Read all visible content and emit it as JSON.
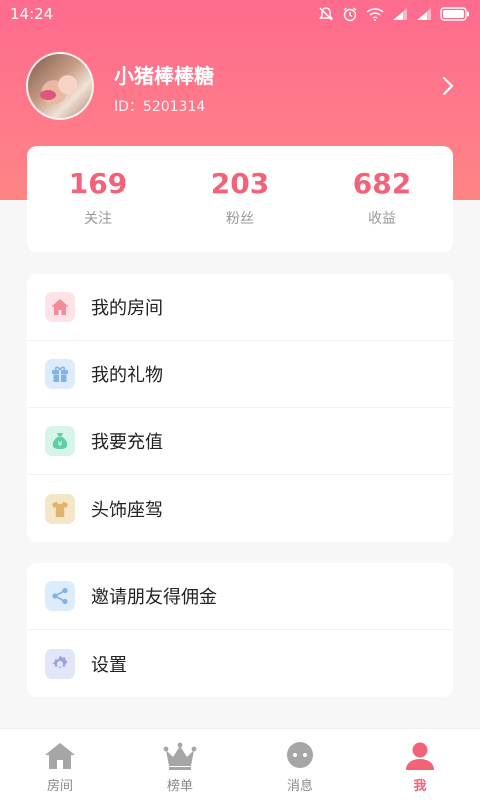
{
  "status_bar": {
    "time": "14:24"
  },
  "profile": {
    "nickname": "小猪棒棒糖",
    "id_text": "ID：5201314"
  },
  "stats": [
    {
      "value": "169",
      "label": "关注"
    },
    {
      "value": "203",
      "label": "粉丝"
    },
    {
      "value": "682",
      "label": "收益"
    }
  ],
  "menu_main": [
    {
      "label": "我的房间",
      "icon": "home-icon",
      "icon_bg": "#fde3e6",
      "icon_color": "#f48b99"
    },
    {
      "label": "我的礼物",
      "icon": "gift-icon",
      "icon_bg": "#dcecfb",
      "icon_color": "#7fb3ea"
    },
    {
      "label": "我要充值",
      "icon": "money-bag-icon",
      "icon_bg": "#d7f4ea",
      "icon_color": "#5fcfa6"
    },
    {
      "label": "头饰座驾",
      "icon": "shirt-icon",
      "icon_bg": "#f6e6c8",
      "icon_color": "#e0b46c"
    }
  ],
  "menu_other": [
    {
      "label": "邀请朋友得佣金",
      "icon": "share-icon",
      "icon_bg": "#dcecfb",
      "icon_color": "#7fb3ea"
    },
    {
      "label": "设置",
      "icon": "settings-icon",
      "icon_bg": "#e3e6f7",
      "icon_color": "#9aa4dc"
    }
  ],
  "tabs": [
    {
      "label": "房间",
      "icon": "house-icon",
      "active": false
    },
    {
      "label": "榜单",
      "icon": "crown-icon",
      "active": false
    },
    {
      "label": "消息",
      "icon": "chat-icon",
      "active": false
    },
    {
      "label": "我",
      "icon": "person-icon",
      "active": true
    }
  ],
  "colors": {
    "accent": "#f2637a",
    "header_top": "#fe6b8d",
    "header_bottom": "#fe8584"
  }
}
